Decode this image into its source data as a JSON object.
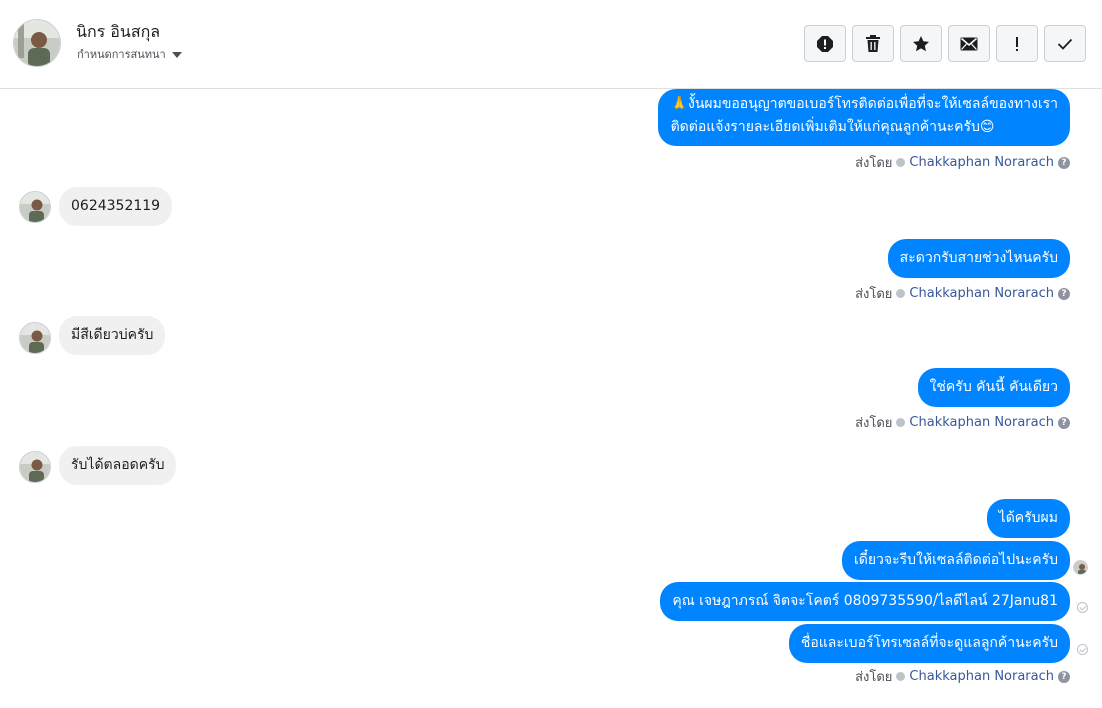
{
  "header": {
    "contact_name": "นิกร อินสกุล",
    "conversation_setting": "กำหนดการสนทนา",
    "actions": [
      {
        "name": "spam-icon"
      },
      {
        "name": "trash-icon"
      },
      {
        "name": "star-icon"
      },
      {
        "name": "mail-icon"
      },
      {
        "name": "exclamation-icon"
      },
      {
        "name": "checkmark-icon"
      }
    ]
  },
  "thread": {
    "sent_by_label": "ส่งโดย",
    "agent_name": "Chakkaphan Norarach",
    "help_glyph": "?",
    "messages": [
      {
        "dir": "out",
        "lines": [
          "🙏งั้นผมขออนุญาตขอเบอร์โทรติดต่อเพื่อที่จะให้เซลล์ของทางเรา",
          "ติดต่อแจ้งรายละเอียดเพิ่มเติมให้แก่คุณลูกค้านะครับ😊"
        ]
      },
      {
        "dir": "in",
        "text": "0624352119"
      },
      {
        "dir": "out",
        "text": "สะดวกรับสายช่วงไหนครับ"
      },
      {
        "dir": "in",
        "text": "มีสีเดียวบ่ครับ"
      },
      {
        "dir": "out",
        "text": "ใช่ครับ คันนี้ คันเดียว"
      },
      {
        "dir": "in",
        "text": "รับได้ตลอดครับ"
      },
      {
        "dir": "out",
        "text": "ได้ครับผม"
      },
      {
        "dir": "out",
        "text": "เดี๋ยวจะรีบให้เซลล์ติดต่อไปนะครับ"
      },
      {
        "dir": "out",
        "text": "คุณ เจษฎาภรณ์ จิตจะโคตร์    0809735590/ไลดีไลน์ 27Janu81"
      },
      {
        "dir": "out",
        "text": "ชื่อและเบอร์โทรเซลล์ที่จะดูแลลูกค้านะครับ"
      }
    ]
  },
  "colors": {
    "outgoing_bubble": "#0084ff",
    "incoming_bubble": "#f1f0f0",
    "agent_link": "#385898"
  }
}
